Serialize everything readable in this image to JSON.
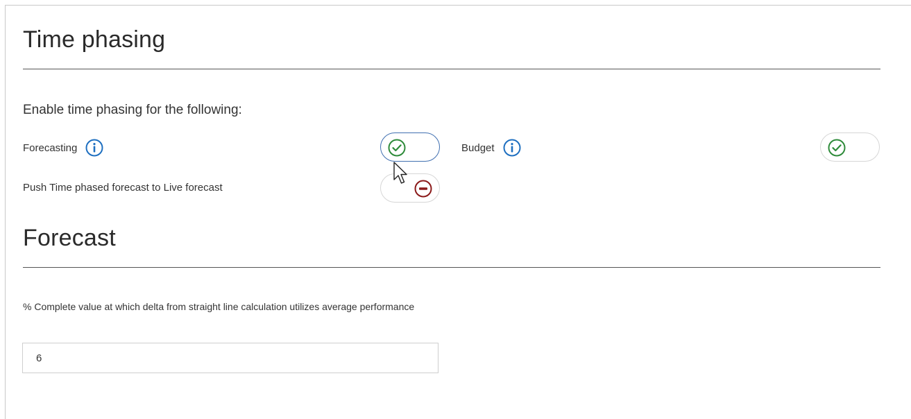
{
  "time_phasing": {
    "title": "Time phasing",
    "subheading": "Enable time phasing for the following:",
    "forecasting": {
      "label": "Forecasting",
      "info_icon": "info-icon",
      "toggle_state": "on"
    },
    "budget": {
      "label": "Budget",
      "info_icon": "info-icon",
      "toggle_state": "on"
    },
    "push_forecast": {
      "label": "Push Time phased forecast to Live forecast",
      "toggle_state": "off"
    }
  },
  "forecast": {
    "title": "Forecast",
    "field_label": "% Complete value at which delta from straight line calculation utilizes average performance",
    "field_value": "6"
  },
  "colors": {
    "toggle_on": "#2e8b3a",
    "toggle_off": "#8b1a1a",
    "info_blue": "#1e6fc0",
    "focus_border": "#3f6fb0"
  }
}
